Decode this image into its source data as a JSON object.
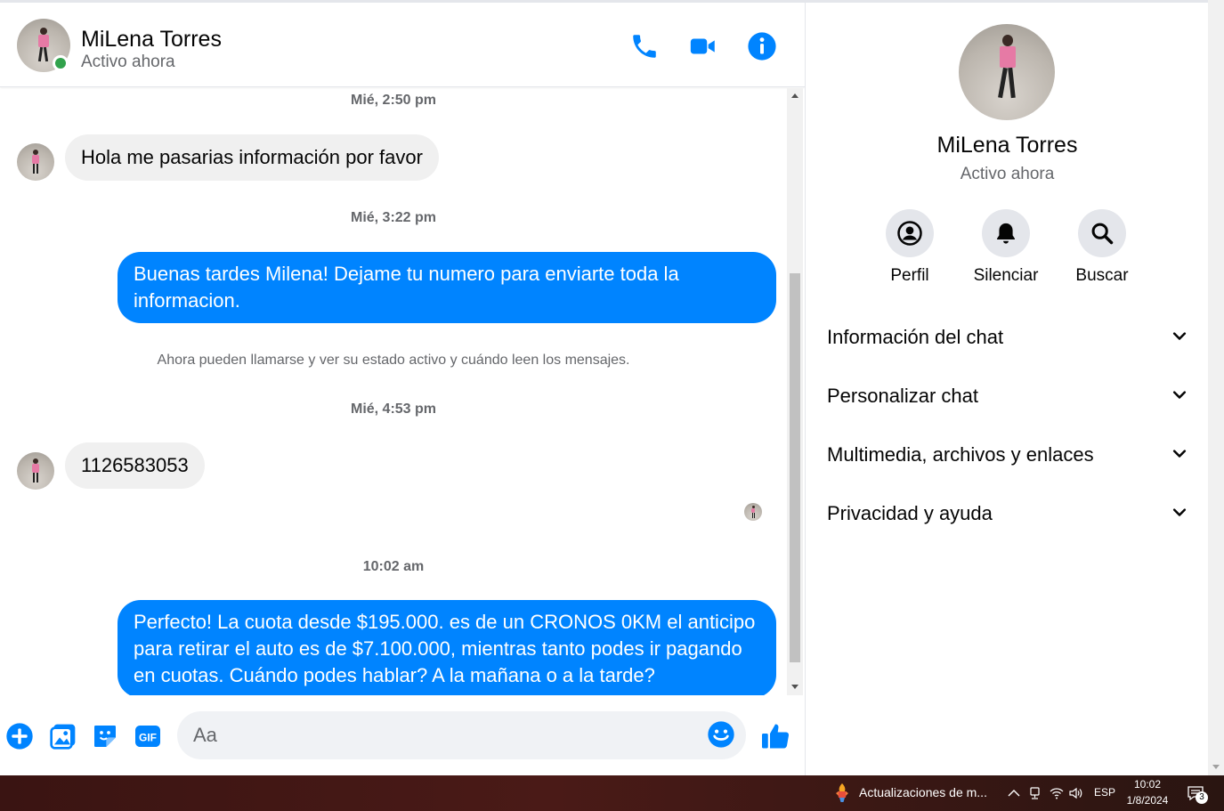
{
  "contact": {
    "name": "MiLena Torres",
    "status": "Activo ahora"
  },
  "header": {
    "icons": [
      "phone-icon",
      "video-icon",
      "info-icon"
    ]
  },
  "messages": {
    "ts1": "Mié, 2:50 pm",
    "in1": "Hola me pasarias información por favor",
    "ts2": "Mié, 3:22 pm",
    "out1": "Buenas tardes Milena! Dejame tu numero para enviarte toda la informacion.",
    "system": "Ahora pueden llamarse y ver su estado activo y cuándo leen los mensajes.",
    "ts3": "Mié, 4:53 pm",
    "in2": "1126583053",
    "ts4": "10:02 am",
    "out2": "Perfecto! La cuota desde $195.000. es de un CRONOS 0KM el anticipo para retirar el auto es de $7.100.000, mientras tanto podes ir pagando en cuotas. Cuándo podes hablar? A la mañana o a la tarde?"
  },
  "composer": {
    "placeholder": "Aa",
    "icons": [
      "plus-icon",
      "image-icon",
      "sticker-icon",
      "gif-icon",
      "emoji-icon",
      "like-icon"
    ],
    "gif_label": "GIF"
  },
  "details": {
    "actions": [
      {
        "label": "Perfil",
        "icon": "profile-icon"
      },
      {
        "label": "Silenciar",
        "icon": "bell-icon"
      },
      {
        "label": "Buscar",
        "icon": "search-icon"
      }
    ],
    "sections": [
      "Información del chat",
      "Personalizar chat",
      "Multimedia, archivos y enlaces",
      "Privacidad y ayuda"
    ]
  },
  "taskbar": {
    "update_label": "Actualizaciones de m...",
    "lang": "ESP",
    "time": "10:02",
    "date": "1/8/2024",
    "notif_count": "3"
  },
  "colors": {
    "accent": "#0084ff",
    "online": "#31a24c",
    "incoming_bubble": "#f0f0f0"
  }
}
